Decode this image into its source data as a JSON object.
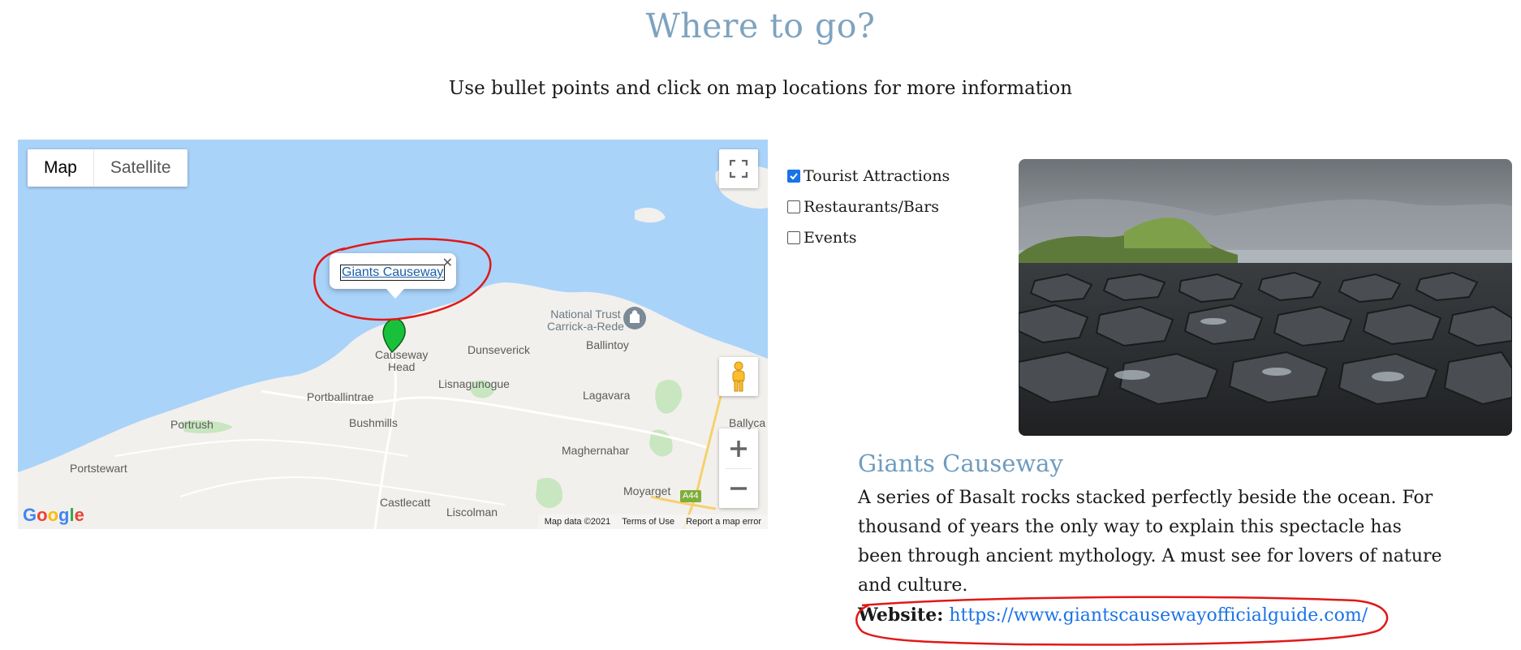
{
  "header": {
    "title": "Where to go?",
    "subtitle": "Use bullet points and click on map locations for more information"
  },
  "map": {
    "type_buttons": [
      "Map",
      "Satellite"
    ],
    "active_type": "Map",
    "infowindow_label": "Giants Causeway",
    "places": {
      "national_trust_1": "National Trust",
      "national_trust_2": "Carrick-a-Rede",
      "ballintoy": "Ballintoy",
      "causeway_head_1": "Causeway",
      "causeway_head_2": "Head",
      "dunseverick": "Dunseverick",
      "portballintrae": "Portballintrae",
      "lisnagunogue": "Lisnagunogue",
      "lagavara": "Lagavara",
      "portrush": "Portrush",
      "bushmills": "Bushmills",
      "ballyca": "Ballyca",
      "maghernahar": "Maghernahar",
      "portstewart": "Portstewart",
      "moyarget": "Moyarget",
      "castlecatt": "Castlecatt",
      "liscolman": "Liscolman",
      "road_a44": "A44"
    },
    "attribution": {
      "map_data": "Map data ©2021",
      "terms": "Terms of Use",
      "report": "Report a map error"
    },
    "logo": [
      "G",
      "o",
      "o",
      "g",
      "l",
      "e"
    ],
    "colors": {
      "water": "#aad3f9",
      "land": "#f2f0ec",
      "park": "#c8e6c0",
      "marker": "#19c13a",
      "annotation": "#e11818"
    }
  },
  "filters": [
    {
      "label": "Tourist Attractions",
      "checked": true
    },
    {
      "label": "Restaurants/Bars",
      "checked": false
    },
    {
      "label": "Events",
      "checked": false
    }
  ],
  "details": {
    "title": "Giants Causeway",
    "description": "A series of Basalt rocks stacked perfectly beside the ocean. For thousand of years the only way to explain this spectacle has been through ancient mythology. A must see for lovers of nature and culture.",
    "website_label": "Website:",
    "website_url": "https://www.giantscausewayofficialguide.com/"
  }
}
